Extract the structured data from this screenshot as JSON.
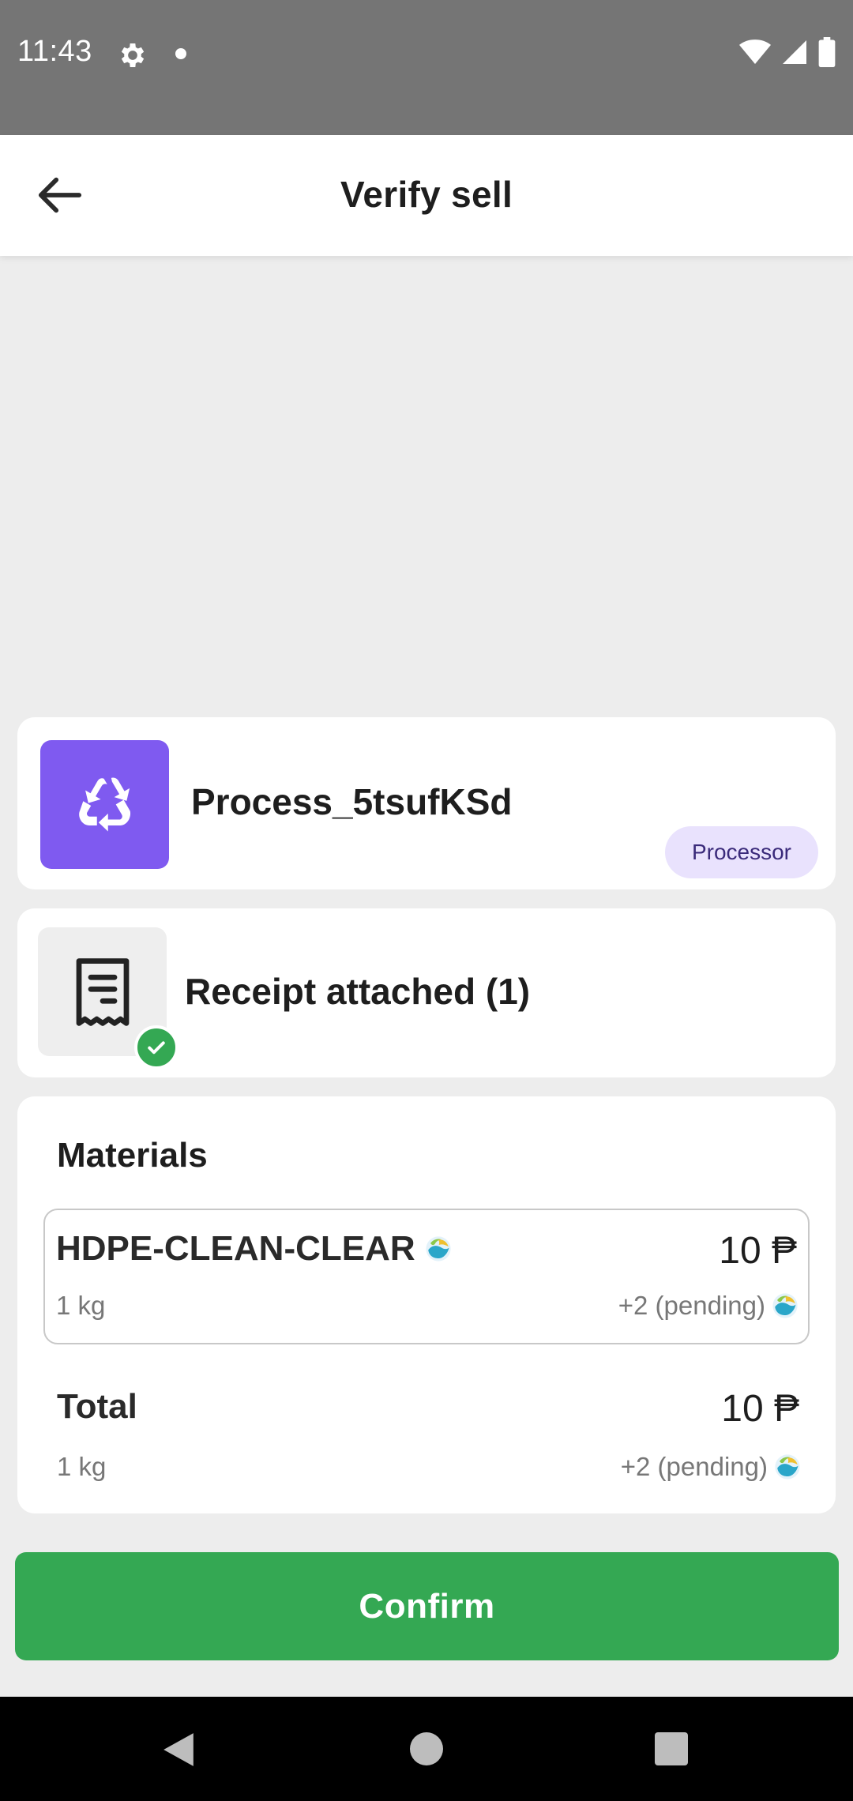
{
  "status_bar": {
    "time": "11:43",
    "icons": [
      "gear-icon",
      "notification-dot-icon",
      "wifi-icon",
      "signal-icon",
      "battery-icon"
    ]
  },
  "app_bar": {
    "title": "Verify sell",
    "back_icon": "arrow-left-icon"
  },
  "process": {
    "name": "Process_5tsufKSd",
    "role": "Processor",
    "avatar_icon": "recycle-icon",
    "avatar_color": "#7f5af0"
  },
  "receipt": {
    "label": "Receipt attached (1)",
    "icon": "receipt-icon",
    "status_icon": "check-circle-icon"
  },
  "materials": {
    "title": "Materials",
    "items": [
      {
        "name": "HDPE-CLEAN-CLEAR",
        "weight": "1 kg",
        "price": "10 ₱",
        "pending": "+2 (pending)"
      }
    ],
    "total": {
      "label": "Total",
      "weight": "1 kg",
      "price": "10 ₱",
      "pending": "+2 (pending)"
    }
  },
  "confirm_label": "Confirm",
  "colors": {
    "accent_green": "#34a853",
    "badge_bg": "#e9e2fd",
    "background": "#ededed"
  }
}
